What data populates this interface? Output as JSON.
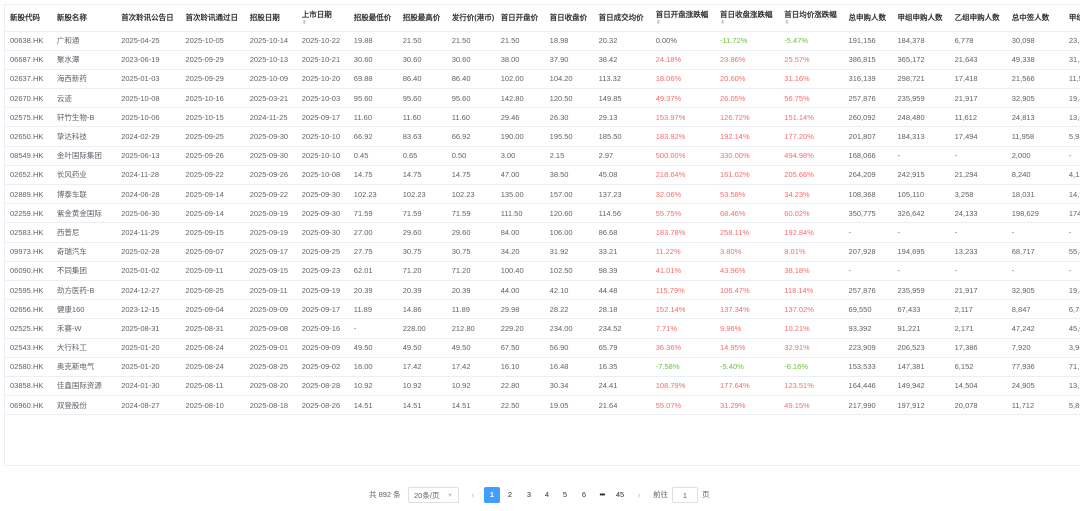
{
  "table": {
    "columns": [
      {
        "label": "新股代码",
        "sortable": false
      },
      {
        "label": "新股名称",
        "sortable": false
      },
      {
        "label": "首次聆讯公告日",
        "sortable": false
      },
      {
        "label": "首次聆讯通过日",
        "sortable": false
      },
      {
        "label": "招股日期",
        "sortable": false
      },
      {
        "label": "上市日期",
        "sortable": true
      },
      {
        "label": "招股最低价",
        "sortable": false
      },
      {
        "label": "招股最高价",
        "sortable": false
      },
      {
        "label": "发行价(港币)",
        "sortable": false
      },
      {
        "label": "首日开盘价",
        "sortable": false
      },
      {
        "label": "首日收盘价",
        "sortable": false
      },
      {
        "label": "首日成交均价",
        "sortable": false
      },
      {
        "label": "首日开盘涨跌幅",
        "sortable": true
      },
      {
        "label": "首日收盘涨跌幅",
        "sortable": true
      },
      {
        "label": "首日均价涨跌幅",
        "sortable": true
      },
      {
        "label": "总申购人数",
        "sortable": false
      },
      {
        "label": "甲组申购人数",
        "sortable": false
      },
      {
        "label": "乙组申购人数",
        "sortable": false
      },
      {
        "label": "总中签人数",
        "sortable": false
      },
      {
        "label": "甲组",
        "sortable": false
      }
    ],
    "rows": [
      [
        "00638.HK",
        "广和通",
        "2025-04-25",
        "2025-10-05",
        "2025-10-14",
        "2025-10-22",
        "19.88",
        "21.50",
        "21.50",
        "21.50",
        "18.98",
        "20.32",
        "0.00%",
        "-11.72%",
        "-5.47%",
        "191,156",
        "184,378",
        "6,778",
        "30,098",
        "23,3"
      ],
      [
        "06687.HK",
        "聚水潭",
        "2023-06-19",
        "2025-09-29",
        "2025-10-13",
        "2025-10-21",
        "30.60",
        "30.60",
        "30.60",
        "38.00",
        "37.90",
        "38.42",
        "24.18%",
        "23.86%",
        "25.57%",
        "386,815",
        "365,172",
        "21,643",
        "49,338",
        "31,2"
      ],
      [
        "02637.HK",
        "海西新药",
        "2025-01-03",
        "2025-09-29",
        "2025-10-09",
        "2025-10-20",
        "69.88",
        "86.40",
        "86.40",
        "102.00",
        "104.20",
        "113.32",
        "18.06%",
        "20.60%",
        "31.16%",
        "316,139",
        "298,721",
        "17,418",
        "21,566",
        "11,5"
      ],
      [
        "02670.HK",
        "云迹",
        "2025-10-08",
        "2025-10-16",
        "2025-03-21",
        "2025-10-03",
        "95.60",
        "95.60",
        "95.60",
        "142.80",
        "120.50",
        "149.85",
        "49.37%",
        "26.05%",
        "56.75%",
        "257,876",
        "235,959",
        "21,917",
        "32,905",
        "19,4"
      ],
      [
        "02575.HK",
        "轩竹生物-B",
        "2025-10-06",
        "2025-10-15",
        "2024-11-25",
        "2025-09-17",
        "11.60",
        "11.60",
        "11.60",
        "29.46",
        "26.30",
        "29.13",
        "153.97%",
        "126.72%",
        "151.14%",
        "260,092",
        "248,480",
        "11,612",
        "24,813",
        "13,6"
      ],
      [
        "02650.HK",
        "挚达科技",
        "2024-02-29",
        "2025-09-25",
        "2025-09-30",
        "2025-10-10",
        "66.92",
        "83.63",
        "66.92",
        "190.00",
        "195.50",
        "185.50",
        "183.92%",
        "192.14%",
        "177.20%",
        "201,807",
        "184,313",
        "17,494",
        "11,958",
        "5,97"
      ],
      [
        "08549.HK",
        "金叶国际集团",
        "2025-06-13",
        "2025-09-26",
        "2025-09-30",
        "2025-10-10",
        "0.45",
        "0.65",
        "0.50",
        "3.00",
        "2.15",
        "2.97",
        "500.00%",
        "330.00%",
        "494.98%",
        "168,066",
        "-",
        "-",
        "2,000",
        "-"
      ],
      [
        "02652.HK",
        "长风药业",
        "2024-11-28",
        "2025-09-22",
        "2025-09-26",
        "2025-10-08",
        "14.75",
        "14.75",
        "14.75",
        "47.00",
        "38.50",
        "45.08",
        "218.64%",
        "161.02%",
        "205.66%",
        "264,209",
        "242,915",
        "21,294",
        "8,240",
        "4,12"
      ],
      [
        "02889.HK",
        "博泰车联",
        "2024-06-28",
        "2025-09-14",
        "2025-09-22",
        "2025-09-30",
        "102.23",
        "102.23",
        "102.23",
        "135.00",
        "157.00",
        "137.23",
        "32.06%",
        "53.58%",
        "34.23%",
        "108,368",
        "105,110",
        "3,258",
        "18,031",
        "14,7"
      ],
      [
        "02259.HK",
        "紫金黄金国际",
        "2025-06-30",
        "2025-09-14",
        "2025-09-19",
        "2025-09-30",
        "71.59",
        "71.59",
        "71.59",
        "111.50",
        "120.60",
        "114.56",
        "55.75%",
        "68.46%",
        "60.02%",
        "350,775",
        "326,642",
        "24,133",
        "198,629",
        "174"
      ],
      [
        "02583.HK",
        "西普尼",
        "2024-11-29",
        "2025-09-15",
        "2025-09-19",
        "2025-09-30",
        "27.00",
        "29.60",
        "29.60",
        "84.00",
        "106.00",
        "86.68",
        "183.78%",
        "258.11%",
        "192.84%",
        "-",
        "-",
        "-",
        "-",
        "-"
      ],
      [
        "09973.HK",
        "奇瑞汽车",
        "2025-02-28",
        "2025-09-07",
        "2025-09-17",
        "2025-09-25",
        "27.75",
        "30.75",
        "30.75",
        "34.20",
        "31.92",
        "33.21",
        "11.22%",
        "3.80%",
        "8.01%",
        "207,928",
        "194,695",
        "13,233",
        "68,717",
        "55,4"
      ],
      [
        "06090.HK",
        "不同集团",
        "2025-01-02",
        "2025-09-11",
        "2025-09-15",
        "2025-09-23",
        "62.01",
        "71.20",
        "71.20",
        "100.40",
        "102.50",
        "98.39",
        "41.01%",
        "43.96%",
        "38.18%",
        "-",
        "-",
        "-",
        "-",
        "-"
      ],
      [
        "02595.HK",
        "劲方医药-B",
        "2024-12-27",
        "2025-08-25",
        "2025-09-11",
        "2025-09-19",
        "20.39",
        "20.39",
        "20.39",
        "44.00",
        "42.10",
        "44.48",
        "115.79%",
        "106.47%",
        "118.14%",
        "257,876",
        "235,959",
        "21,917",
        "32,905",
        "19,4"
      ],
      [
        "02656.HK",
        "健康160",
        "2023-12-15",
        "2025-09-04",
        "2025-09-09",
        "2025-09-17",
        "11.89",
        "14.86",
        "11.89",
        "29.98",
        "28.22",
        "28.18",
        "152.14%",
        "137.34%",
        "137.02%",
        "69,550",
        "67,433",
        "2,117",
        "8,847",
        "6,73"
      ],
      [
        "02525.HK",
        "禾赛-W",
        "2025-08-31",
        "2025-08-31",
        "2025-09-08",
        "2025-09-16",
        "-",
        "228.00",
        "212.80",
        "229.20",
        "234.00",
        "234.52",
        "7.71%",
        "9.96%",
        "10.21%",
        "93,392",
        "91,221",
        "2,171",
        "47,242",
        "45,0"
      ],
      [
        "02543.HK",
        "大行科工",
        "2025-01-20",
        "2025-08-24",
        "2025-09-01",
        "2025-09-09",
        "49.50",
        "49.50",
        "49.50",
        "67.50",
        "56.90",
        "65.79",
        "36.36%",
        "14.95%",
        "32.91%",
        "223,909",
        "206,523",
        "17,386",
        "7,920",
        "3,96"
      ],
      [
        "02580.HK",
        "奥克斯电气",
        "2025-01-20",
        "2025-08-24",
        "2025-08-25",
        "2025-09-02",
        "16.00",
        "17.42",
        "17.42",
        "16.10",
        "16.48",
        "16.35",
        "-7.58%",
        "-5.40%",
        "-6.16%",
        "153,533",
        "147,381",
        "6,152",
        "77,936",
        "71,7"
      ],
      [
        "03858.HK",
        "佳鑫国际资源",
        "2024-01-30",
        "2025-08-11",
        "2025-08-20",
        "2025-08-28",
        "10.92",
        "10.92",
        "10.92",
        "22.80",
        "30.34",
        "24.41",
        "108.79%",
        "177.64%",
        "123.51%",
        "164,446",
        "149,942",
        "14,504",
        "24,905",
        "13,7"
      ],
      [
        "06960.HK",
        "双登股份",
        "2024-08-27",
        "2025-08-10",
        "2025-08-18",
        "2025-08-26",
        "14.51",
        "14.51",
        "14.51",
        "22.50",
        "19.05",
        "21.64",
        "55.07%",
        "31.29%",
        "49.15%",
        "217,990",
        "197,912",
        "20,078",
        "11,712",
        "5,85"
      ]
    ],
    "percent_columns": [
      12,
      13,
      14
    ],
    "sort_icon": "sort-caret-icon"
  },
  "pagination": {
    "total_text": "共 892 条",
    "page_size": "20条/页",
    "pages": [
      "1",
      "2",
      "3",
      "4",
      "5",
      "6"
    ],
    "current_page": "1",
    "ellipsis": "•••",
    "last_page": "45",
    "prev_icon": "chevron-left-icon",
    "next_icon": "chevron-right-icon",
    "goto_label": "前往",
    "goto_value": "1",
    "goto_suffix": "页"
  },
  "colors": {
    "up": "#f56c6c",
    "down": "#67c23a",
    "accent": "#409eff",
    "header_text": "#303133",
    "body_text": "#606266",
    "border": "#ebeef5"
  }
}
